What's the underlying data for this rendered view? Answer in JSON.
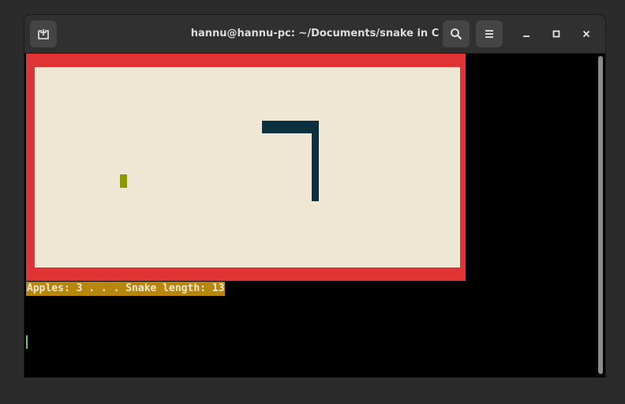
{
  "window": {
    "title": "hannu@hannu-pc: ~/Documents/snake in C",
    "icons": {
      "new_tab": "new-tab-icon",
      "search": "search-icon",
      "menu": "hamburger-menu-icon",
      "minimize": "minimize-icon",
      "maximize": "maximize-icon",
      "close": "close-icon"
    }
  },
  "terminal": {
    "status_line": "Apples: 3 . . . Snake length: 13",
    "apples": 3,
    "snake_length": 13
  },
  "colors": {
    "game_border": "#e03333",
    "game_field": "#efe6d3",
    "snake": "#0b3140",
    "apple": "#8a9a00",
    "status_background": "#b8860b",
    "cursor": "#5fd35f"
  }
}
